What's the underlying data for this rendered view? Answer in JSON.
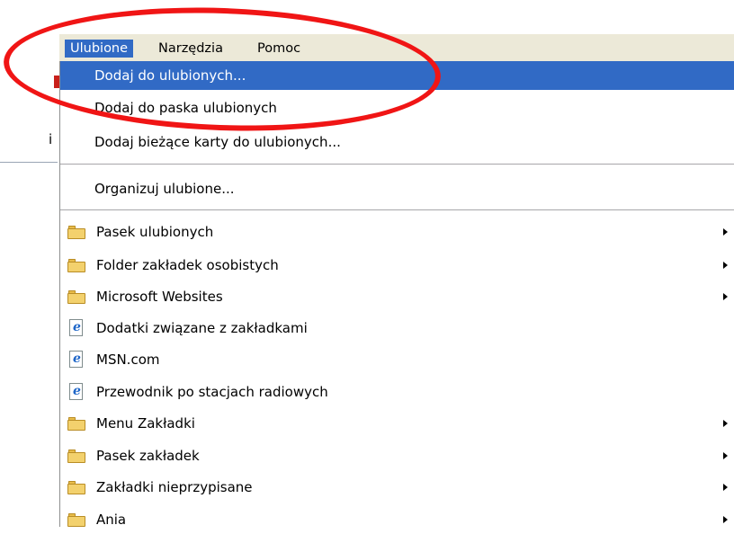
{
  "menubar": {
    "items": [
      "Ulubione",
      "Narzędzia",
      "Pomoc"
    ]
  },
  "left_strip": {
    "char": "i"
  },
  "menu": {
    "items": [
      {
        "label": "Dodaj do ulubionych..."
      },
      {
        "label": "Dodaj do paska ulubionych"
      },
      {
        "label": "Dodaj bieżące karty do ulubionych..."
      },
      {
        "label": "Organizuj ulubione..."
      },
      {
        "label": "Pasek ulubionych",
        "icon": "folder-icon"
      },
      {
        "label": "Folder zakładek osobistych",
        "icon": "folder-icon"
      },
      {
        "label": "Microsoft Websites",
        "icon": "folder-icon"
      },
      {
        "label": "Dodatki związane z zakładkami",
        "icon": "ie-page-icon"
      },
      {
        "label": "MSN.com",
        "icon": "ie-page-icon"
      },
      {
        "label": "Przewodnik po stacjach radiowych",
        "icon": "ie-page-icon"
      },
      {
        "label": "Menu Zakładki",
        "icon": "folder-icon"
      },
      {
        "label": "Pasek zakładek",
        "icon": "folder-icon"
      },
      {
        "label": "Zakładki nieprzypisane",
        "icon": "folder-icon"
      },
      {
        "label": "Ania",
        "icon": "folder-icon"
      }
    ]
  },
  "colors": {
    "highlight": "#316ac5",
    "menubar": "#ece9d8",
    "annotation": "#f01515"
  }
}
